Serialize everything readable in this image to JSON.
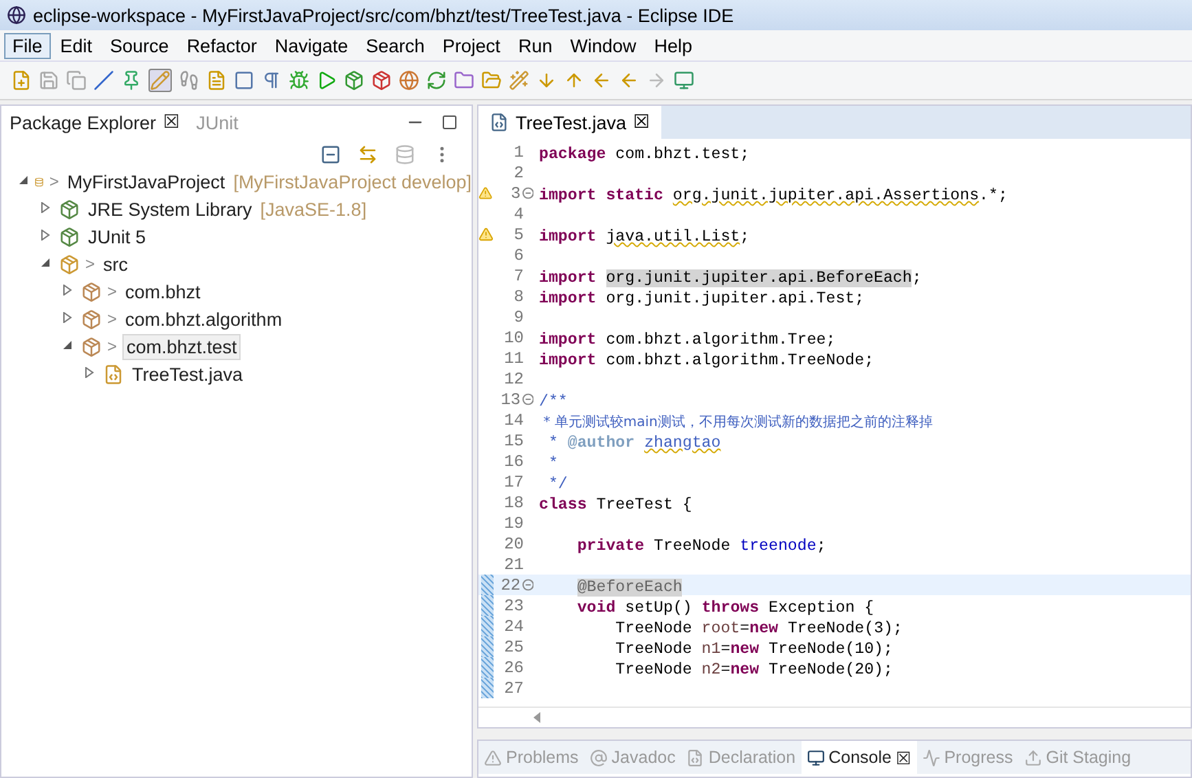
{
  "window": {
    "title": "eclipse-workspace - MyFirstJavaProject/src/com/bhzt/test/TreeTest.java - Eclipse IDE"
  },
  "menu": [
    {
      "label": "File",
      "selected": true
    },
    {
      "label": "Edit",
      "selected": false
    },
    {
      "label": "Source",
      "selected": false
    },
    {
      "label": "Refactor",
      "selected": false
    },
    {
      "label": "Navigate",
      "selected": false
    },
    {
      "label": "Search",
      "selected": false
    },
    {
      "label": "Project",
      "selected": false
    },
    {
      "label": "Run",
      "selected": false
    },
    {
      "label": "Window",
      "selected": false
    },
    {
      "label": "Help",
      "selected": false
    }
  ],
  "left_panel": {
    "tabs": [
      {
        "label": "Package Explorer",
        "selected": true,
        "close": "☒"
      },
      {
        "label": "JUnit",
        "selected": false
      }
    ],
    "tree": [
      {
        "kind": "project",
        "marker": ">",
        "label": "MyFirstJavaProject",
        "decoration": "[MyFirstJavaProject develop]",
        "expanded": true,
        "selected": false,
        "children": [
          {
            "kind": "library",
            "label": "JRE System Library",
            "decoration": "[JavaSE-1.8]",
            "expanded": false,
            "selected": false
          },
          {
            "kind": "library",
            "label": "JUnit 5",
            "expanded": false,
            "selected": false
          },
          {
            "kind": "source",
            "marker": ">",
            "label": "src",
            "expanded": true,
            "selected": false,
            "children": [
              {
                "kind": "package",
                "marker": ">",
                "label": "com.bhzt",
                "expanded": false,
                "selected": false
              },
              {
                "kind": "package",
                "marker": ">",
                "label": "com.bhzt.algorithm",
                "expanded": false,
                "selected": false
              },
              {
                "kind": "package",
                "marker": ">",
                "label": "com.bhzt.test",
                "expanded": true,
                "selected": true,
                "children": [
                  {
                    "kind": "file",
                    "label": "TreeTest.java",
                    "expanded": false,
                    "selected": false
                  }
                ]
              }
            ]
          }
        ]
      }
    ]
  },
  "editor": {
    "tab": {
      "label": "TreeTest.java",
      "close": "☒"
    },
    "lines": [
      {
        "number": "1",
        "current": false,
        "tokens": [
          {
            "kind": "keyword",
            "text": "package"
          },
          {
            "kind": "plain",
            "text": " com.bhzt.test;"
          }
        ]
      },
      {
        "number": "2",
        "current": false
      },
      {
        "number": "3",
        "current": false,
        "warning": true,
        "fold": true,
        "tokens": [
          {
            "kind": "keyword",
            "text": "import static "
          },
          {
            "kind": "plain",
            "text": "org.junit.jupiter.api.Assertions",
            "squiggle": true
          },
          {
            "kind": "plain",
            "text": ".*;"
          }
        ]
      },
      {
        "number": "4",
        "current": false
      },
      {
        "number": "5",
        "current": false,
        "warning": true,
        "tokens": [
          {
            "kind": "keyword",
            "text": "import "
          },
          {
            "kind": "plain",
            "text": "java.util.List",
            "squiggle": true
          },
          {
            "kind": "plain",
            "text": ";"
          }
        ]
      },
      {
        "number": "6",
        "current": false
      },
      {
        "number": "7",
        "current": false,
        "tokens": [
          {
            "kind": "keyword",
            "text": "import "
          },
          {
            "kind": "plain",
            "text": "org.junit.jupiter.api.BeforeEach",
            "highlighted": true
          },
          {
            "kind": "plain",
            "text": ";"
          }
        ]
      },
      {
        "number": "8",
        "current": false,
        "tokens": [
          {
            "kind": "keyword",
            "text": "import"
          },
          {
            "kind": "plain",
            "text": " org.junit.jupiter.api.Test;"
          }
        ]
      },
      {
        "number": "9",
        "current": false
      },
      {
        "number": "10",
        "current": false,
        "tokens": [
          {
            "kind": "keyword",
            "text": "import"
          },
          {
            "kind": "plain",
            "text": " com.bhzt.algorithm.Tree;"
          }
        ]
      },
      {
        "number": "11",
        "current": false,
        "tokens": [
          {
            "kind": "keyword",
            "text": "import"
          },
          {
            "kind": "plain",
            "text": " com.bhzt.algorithm.TreeNode;"
          }
        ]
      },
      {
        "number": "12",
        "current": false
      },
      {
        "number": "13",
        "current": false,
        "fold": true,
        "tokens": [
          {
            "kind": "javadoc",
            "text": "/**"
          }
        ]
      },
      {
        "number": "14",
        "current": false,
        "tokens": [
          {
            "kind": "javadoc",
            "text": " * 单元测试较main测试，不用每次测试新的数据把之前的注释掉"
          }
        ]
      },
      {
        "number": "15",
        "current": false,
        "tokens": [
          {
            "kind": "javadoc",
            "text": " * "
          },
          {
            "kind": "tag",
            "text": "@author "
          },
          {
            "kind": "javadoc",
            "text": "zhangtao",
            "squiggle": true
          }
        ]
      },
      {
        "number": "16",
        "current": false,
        "tokens": [
          {
            "kind": "javadoc",
            "text": " *"
          }
        ]
      },
      {
        "number": "17",
        "current": false,
        "tokens": [
          {
            "kind": "javadoc",
            "text": " */"
          }
        ]
      },
      {
        "number": "18",
        "current": false,
        "tokens": [
          {
            "kind": "keyword",
            "text": "class"
          },
          {
            "kind": "plain",
            "text": " TreeTest {"
          }
        ]
      },
      {
        "number": "19",
        "current": false
      },
      {
        "number": "20",
        "current": false,
        "tokens": [
          {
            "kind": "keyword",
            "text": "    private"
          },
          {
            "kind": "plain",
            "text": " TreeNode "
          },
          {
            "kind": "field",
            "text": "treenode"
          },
          {
            "kind": "plain",
            "text": ";"
          }
        ]
      },
      {
        "number": "21",
        "current": false
      },
      {
        "number": "22",
        "current": true,
        "fold": true,
        "changed": true,
        "tokens": [
          {
            "kind": "annotation",
            "text": "    @BeforeEach",
            "highlighted": true
          }
        ]
      },
      {
        "number": "23",
        "current": false,
        "changed": true,
        "tokens": [
          {
            "kind": "keyword",
            "text": "    void"
          },
          {
            "kind": "plain",
            "text": " setUp() "
          },
          {
            "kind": "keyword",
            "text": "throws"
          },
          {
            "kind": "plain",
            "text": " Exception {"
          }
        ]
      },
      {
        "number": "24",
        "current": false,
        "changed": true,
        "tokens": [
          {
            "kind": "plain",
            "text": "        TreeNode "
          },
          {
            "kind": "local",
            "text": "root"
          },
          {
            "kind": "plain",
            "text": "="
          },
          {
            "kind": "keyword",
            "text": "new"
          },
          {
            "kind": "plain",
            "text": " TreeNode(3);"
          }
        ]
      },
      {
        "number": "25",
        "current": false,
        "changed": true,
        "tokens": [
          {
            "kind": "plain",
            "text": "        TreeNode "
          },
          {
            "kind": "local",
            "text": "n1"
          },
          {
            "kind": "plain",
            "text": "="
          },
          {
            "kind": "keyword",
            "text": "new"
          },
          {
            "kind": "plain",
            "text": " TreeNode(10);"
          }
        ]
      },
      {
        "number": "26",
        "current": false,
        "changed": true,
        "tokens": [
          {
            "kind": "plain",
            "text": "        TreeNode "
          },
          {
            "kind": "local",
            "text": "n2"
          },
          {
            "kind": "plain",
            "text": "="
          },
          {
            "kind": "keyword",
            "text": "new"
          },
          {
            "kind": "plain",
            "text": " TreeNode(20);"
          }
        ]
      },
      {
        "number": "27",
        "current": false,
        "changed": true
      }
    ]
  },
  "bottom_panel": {
    "tabs": [
      {
        "kind": "problems",
        "label": "Problems",
        "selected": false
      },
      {
        "kind": "javadoc",
        "label": "Javadoc",
        "selected": false
      },
      {
        "kind": "declaration",
        "label": "Declaration",
        "selected": false
      },
      {
        "kind": "console",
        "label": "Console",
        "selected": true,
        "close": "☒"
      },
      {
        "kind": "progress",
        "label": "Progress",
        "selected": false
      },
      {
        "kind": "git",
        "label": "Git Staging",
        "selected": false
      }
    ]
  }
}
